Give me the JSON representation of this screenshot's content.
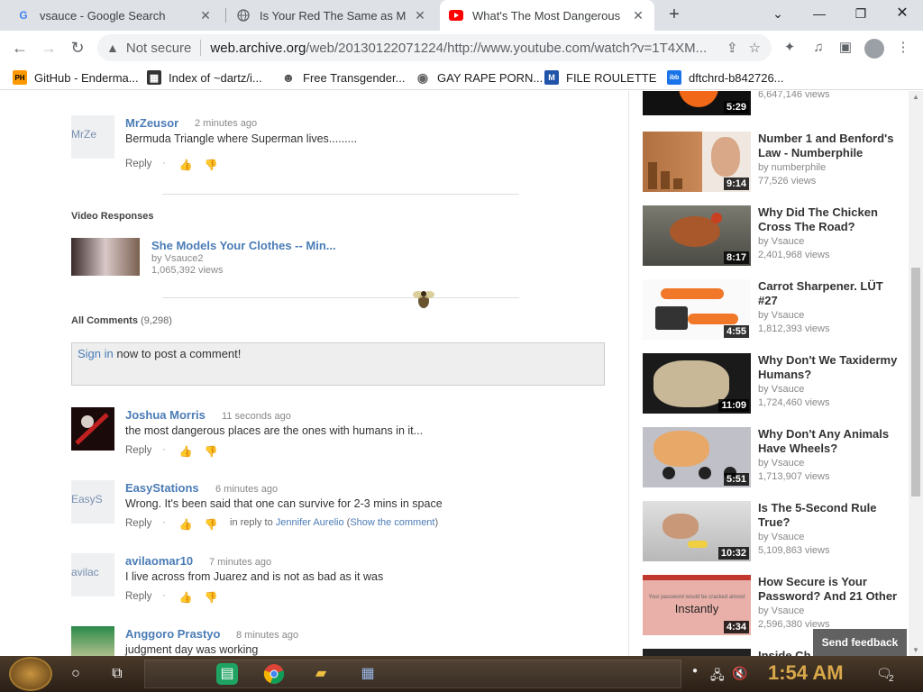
{
  "tabs": [
    {
      "title": "vsauce - Google Search",
      "icon": "google-icon"
    },
    {
      "title": "Is Your Red The Same as My R",
      "icon": "globe-icon"
    },
    {
      "title": "What's The Most Dangerous Pl",
      "icon": "youtube-icon"
    }
  ],
  "toolbar": {
    "security": "Not secure",
    "url_host": "web.archive.org",
    "url_path": "/web/20130122071224/http://www.youtube.com/watch?v=1T4XM..."
  },
  "bookmarks": [
    {
      "label": "GitHub - Enderma...",
      "icon": "PH",
      "color": "#ff9900"
    },
    {
      "label": "Index of ~dartz/i...",
      "icon": "▦",
      "color": "#333333"
    },
    {
      "label": "Free Transgender...",
      "icon": "☻",
      "color": "#555555"
    },
    {
      "label": "GAY RAPE PORN...",
      "icon": "◉",
      "color": "#666666"
    },
    {
      "label": "FILE ROULETTE",
      "icon": "M",
      "color": "#2255aa"
    },
    {
      "label": "dftchrd-b842726...",
      "icon": "ibb",
      "color": "#1a73e8"
    }
  ],
  "comments_top": {
    "author": "MrZeusor",
    "time": "2 minutes ago",
    "text": "Bermuda Triangle where Superman lives.........",
    "avatar_alt": "MrZe",
    "reply": "Reply"
  },
  "video_responses": {
    "heading": "Video Responses",
    "items": [
      {
        "title": "She Models Your Clothes -- Min...",
        "by": "by Vsauce2",
        "views": "1,065,392 views"
      }
    ]
  },
  "all_comments": {
    "heading": "All Comments",
    "count": "(9,298)",
    "signin_link": "Sign in",
    "signin_text": " now to post a comment!"
  },
  "comments": [
    {
      "author": "Joshua Morris",
      "time": "11 seconds ago",
      "text": "the most dangerous places are the ones with humans in it...",
      "avatar_alt": "",
      "reply": "Reply"
    },
    {
      "author": "EasyStations",
      "time": "6 minutes ago",
      "text": "Wrong. It's been said that one can survive for 2-3 mins in space",
      "avatar_alt": "EasyS",
      "reply": "Reply",
      "in_reply_prefix": "in reply to",
      "in_reply_user": "Jennifer Aurelio",
      "show_comment": "Show the comment"
    },
    {
      "author": "avilaomar10",
      "time": "7 minutes ago",
      "text": "I live across from Juarez and is not as bad as it was",
      "avatar_alt": "avilac",
      "reply": "Reply"
    },
    {
      "author": "Anggoro Prastyo",
      "time": "8 minutes ago",
      "text": "judgment day was working",
      "avatar_alt": "",
      "reply": "Reply"
    }
  ],
  "sidebar_videos": [
    {
      "title": "",
      "by": "",
      "views": "6,647,146 views",
      "duration": "5:29"
    },
    {
      "title": "Number 1 and Benford's Law - Numberphile",
      "by": "by numberphile",
      "views": "77,526 views",
      "duration": "9:14"
    },
    {
      "title": "Why Did The Chicken Cross The Road?",
      "by": "by Vsauce",
      "views": "2,401,968 views",
      "duration": "8:17"
    },
    {
      "title": "Carrot Sharpener. LÜT #27",
      "by": "by Vsauce",
      "views": "1,812,393 views",
      "duration": "4:55"
    },
    {
      "title": "Why Don't We Taxidermy Humans?",
      "by": "by Vsauce",
      "views": "1,724,460 views",
      "duration": "11:09"
    },
    {
      "title": "Why Don't Any Animals Have Wheels?",
      "by": "by Vsauce",
      "views": "1,713,907 views",
      "duration": "5:51"
    },
    {
      "title": "Is The 5-Second Rule True?",
      "by": "by Vsauce",
      "views": "5,109,863 views",
      "duration": "10:32"
    },
    {
      "title": "How Secure is Your Password? And 21 Other",
      "by": "by Vsauce",
      "views": "2,596,380 views",
      "duration": "4:34",
      "thumb_text_top": "Your password would be cracked almost",
      "thumb_text_main": "Instantly"
    },
    {
      "title": "Inside Ch",
      "by": "",
      "views": "",
      "duration": ""
    }
  ],
  "feedback": "Send feedback",
  "taskbar": {
    "clock": "1:54 AM",
    "notifications": "2"
  }
}
